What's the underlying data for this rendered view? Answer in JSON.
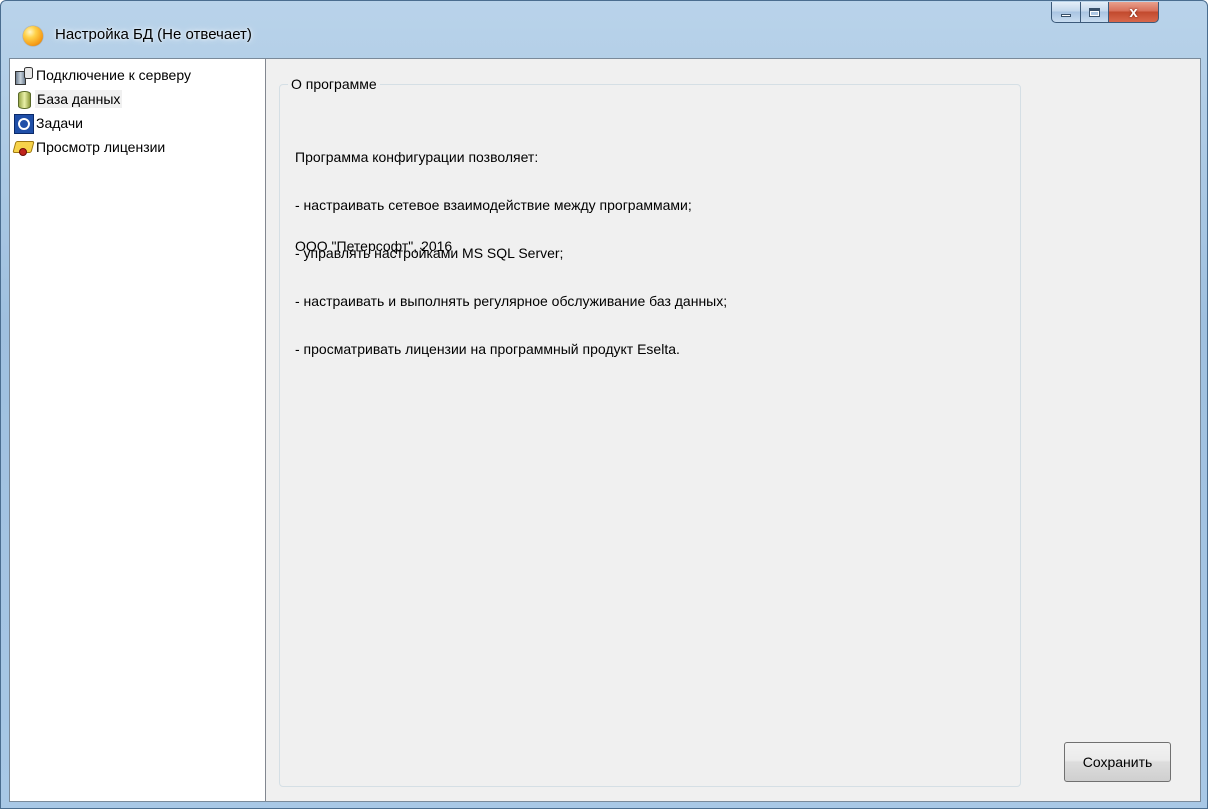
{
  "window": {
    "title": "Настройка БД (Не отвечает)",
    "close_glyph": "x"
  },
  "tree": {
    "items": [
      {
        "label": "Подключение к серверу",
        "icon": "server-connection-icon"
      },
      {
        "label": "База данных",
        "icon": "database-icon",
        "selected": true
      },
      {
        "label": "Задачи",
        "icon": "tasks-icon"
      },
      {
        "label": "Просмотр лицензии",
        "icon": "license-certificate-icon"
      }
    ]
  },
  "about": {
    "legend": "О программе",
    "lines": [
      "Программа конфигурации позволяет:",
      "- настраивать сетевое взаимодействие между программами;",
      "- управлять настройками MS SQL Server;",
      "- настраивать и выполнять регулярное обслуживание баз данных;",
      "- просматривать лицензии на программный продукт Eselta."
    ],
    "copyright": "ООО \"Петерсофт\", 2016"
  },
  "buttons": {
    "save_label": "Сохранить"
  },
  "colors": {
    "titlebar": "#a8c8e6",
    "client_bg": "#f0f0f0",
    "close_button": "#c24a2e"
  }
}
